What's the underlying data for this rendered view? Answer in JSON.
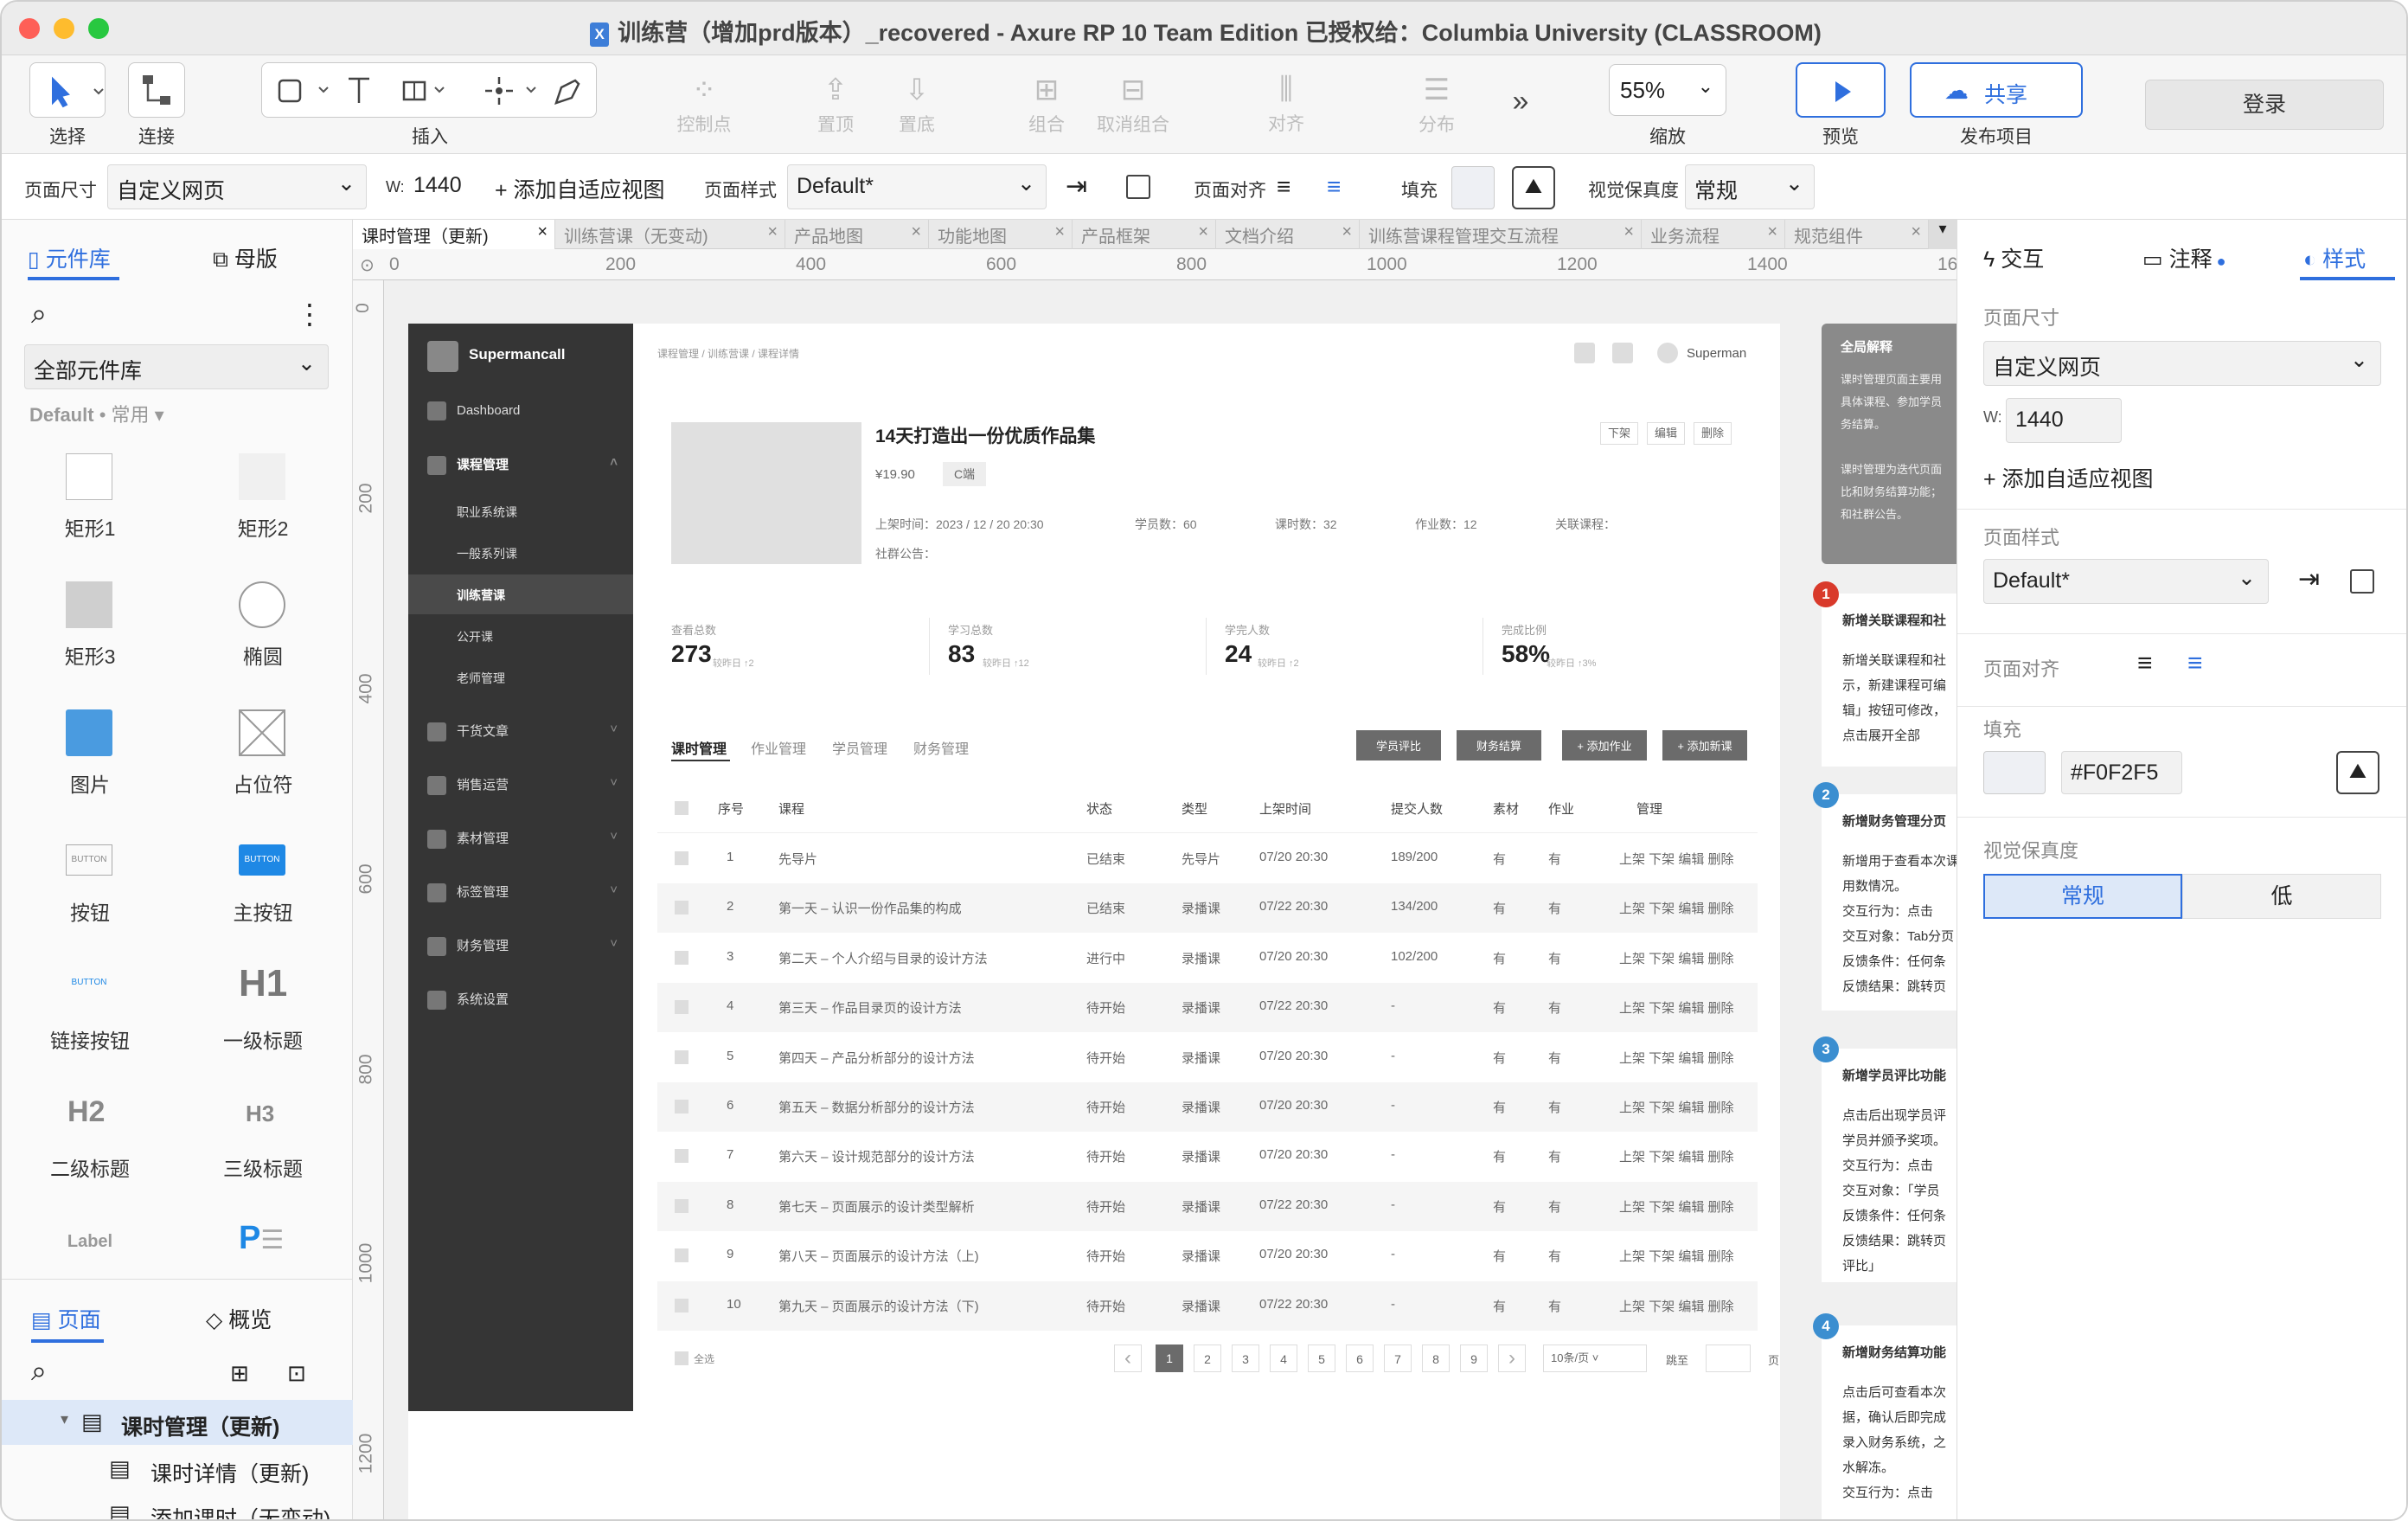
{
  "window": {
    "title": "训练营（增加prd版本）_recovered - Axure RP 10 Team Edition  已授权给：Columbia University (CLASSROOM)"
  },
  "toolbar": {
    "select": "选择",
    "connect": "连接",
    "insert": "插入",
    "control_points": "控制点",
    "front": "置顶",
    "back": "置底",
    "group": "组合",
    "ungroup": "取消组合",
    "align": "对齐",
    "distribute": "分布",
    "more": "»",
    "zoom_value": "55%",
    "zoom": "缩放",
    "preview": "预览",
    "publish": "发布项目",
    "share": "共享",
    "login": "登录"
  },
  "propbar": {
    "page_size_label": "页面尺寸",
    "page_size": "自定义网页",
    "w_label": "W:",
    "w_value": "1440",
    "add_view": "+ 添加自适应视图",
    "page_style_label": "页面样式",
    "page_style": "Default*",
    "page_align_label": "页面对齐",
    "fill_label": "填充",
    "fidelity_label": "视觉保真度",
    "fidelity": "常规"
  },
  "left": {
    "tab_library": "元件库",
    "tab_masters": "母版",
    "library_select": "全部元件库",
    "lib_default": "Default",
    "lib_common": "• 常用",
    "widgets": [
      "矩形1",
      "矩形2",
      "矩形3",
      "椭圆",
      "图片",
      "占位符",
      "按钮",
      "主按钮",
      "链接按钮",
      "一级标题",
      "二级标题",
      "三级标题",
      "Label"
    ],
    "tab_pages": "页面",
    "tab_outline": "概览",
    "pages": [
      "课时管理（更新)",
      "课时详情（更新)",
      "添加课时（无变动)"
    ]
  },
  "tabs": [
    "课时管理（更新)",
    "训练营课（无变动)",
    "产品地图",
    "功能地图",
    "产品框架",
    "文档介绍",
    "训练营课程管理交互流程",
    "业务流程",
    "规范组件"
  ],
  "ruler": {
    "h": [
      "0",
      "200",
      "400",
      "600",
      "800",
      "1000",
      "1200",
      "1400",
      "16"
    ],
    "v": [
      "0",
      "200",
      "400",
      "600",
      "800",
      "1000",
      "1200"
    ]
  },
  "proto": {
    "brand": "Supermancall",
    "user": "Superman",
    "menu": [
      "Dashboard",
      "课程管理",
      "职业系统课",
      "一般系列课",
      "训练营课",
      "公开课",
      "老师管理",
      "干货文章",
      "销售运营",
      "素材管理",
      "标签管理",
      "财务管理",
      "系统设置"
    ],
    "breadcrumb": "课程管理 / 训练营课 / 课程详情",
    "course_title": "14天打造出一份优质作品集",
    "price": "¥19.90",
    "tag": "C端",
    "meta": [
      "上架时间：2023 / 12 / 20 20:30",
      "学员数：60",
      "课时数：32",
      "作业数：12",
      "关联课程："
    ],
    "community": "社群公告：",
    "actions": [
      "下架",
      "编辑",
      "删除"
    ],
    "stats": [
      {
        "label": "查看总数",
        "value": "273",
        "delta": "较昨日 ↑2"
      },
      {
        "label": "学习总数",
        "value": "83",
        "delta": "较昨日 ↑12"
      },
      {
        "label": "学完人数",
        "value": "24",
        "delta": "较昨日 ↑2"
      },
      {
        "label": "完成比例",
        "value": "58%",
        "delta": "较昨日 ↑3%"
      }
    ],
    "subtabs": [
      "课时管理",
      "作业管理",
      "学员管理",
      "财务管理"
    ],
    "buttons": [
      "学员评比",
      "财务结算",
      "+ 添加作业",
      "+ 添加新课"
    ],
    "headers": [
      "序号",
      "课程",
      "状态",
      "类型",
      "上架时间",
      "提交人数",
      "素材",
      "作业",
      "管理"
    ],
    "rows": [
      [
        "1",
        "先导片",
        "已结束",
        "先导片",
        "07/20 20:30",
        "189/200",
        "有",
        "有"
      ],
      [
        "2",
        "第一天 – 认识一份作品集的构成",
        "已结束",
        "录播课",
        "07/22 20:30",
        "134/200",
        "有",
        "有"
      ],
      [
        "3",
        "第二天 – 个人介绍与目录的设计方法",
        "进行中",
        "录播课",
        "07/20 20:30",
        "102/200",
        "有",
        "有"
      ],
      [
        "4",
        "第三天 – 作品目录页的设计方法",
        "待开始",
        "录播课",
        "07/22 20:30",
        "-",
        "有",
        "有"
      ],
      [
        "5",
        "第四天 – 产品分析部分的设计方法",
        "待开始",
        "录播课",
        "07/20 20:30",
        "-",
        "有",
        "有"
      ],
      [
        "6",
        "第五天 – 数据分析部分的设计方法",
        "待开始",
        "录播课",
        "07/20 20:30",
        "-",
        "有",
        "有"
      ],
      [
        "7",
        "第六天 – 设计规范部分的设计方法",
        "待开始",
        "录播课",
        "07/20 20:30",
        "-",
        "有",
        "有"
      ],
      [
        "8",
        "第七天 – 页面展示的设计类型解析",
        "待开始",
        "录播课",
        "07/22 20:30",
        "-",
        "有",
        "有"
      ],
      [
        "9",
        "第八天 – 页面展示的设计方法（上)",
        "待开始",
        "录播课",
        "07/20 20:30",
        "-",
        "有",
        "有"
      ],
      [
        "10",
        "第九天 – 页面展示的设计方法（下)",
        "待开始",
        "录播课",
        "07/22 20:30",
        "-",
        "有",
        "有"
      ]
    ],
    "row_actions": "上架  下架  编辑  删除",
    "select_all": "全选",
    "pages": [
      "1",
      "2",
      "3",
      "4",
      "5",
      "6",
      "7",
      "8",
      "9"
    ],
    "page_size": "10条/页",
    "jump": "跳至",
    "page_unit": "页"
  },
  "notes": {
    "global_title": "全局解释",
    "global_body": [
      "课时管理页面主要用",
      "具体课程、参加学员",
      "务结算。",
      "",
      "课时管理为迭代页面",
      "比和财务结算功能；",
      "和社群公告。"
    ],
    "items": [
      {
        "num": "1",
        "color": "#d93a2b",
        "title": "新增关联课程和社",
        "body": [
          "新增关联课程和社",
          "示，新建课程可编",
          "辑」按钮可修改，",
          "点击展开全部"
        ]
      },
      {
        "num": "2",
        "color": "#3b8ed0",
        "title": "新增财务管理分页",
        "body": [
          "新增用于查看本次课程",
          "用数情况。",
          "交互行为：点击",
          "交互对象：Tab分页",
          "反馈条件：任何条",
          "反馈结果：跳转页"
        ]
      },
      {
        "num": "3",
        "color": "#3b8ed0",
        "title": "新增学员评比功能",
        "body": [
          "点击后出现学员评",
          "学员并颁予奖项。",
          "交互行为：点击",
          "交互对象：「学员",
          "反馈条件：任何条",
          "反馈结果：跳转页",
          "评比」"
        ]
      },
      {
        "num": "4",
        "color": "#3b8ed0",
        "title": "新增财务结算功能",
        "body": [
          "点击后可查看本次",
          "据，确认后即完成",
          "录入财务系统，之",
          "水解冻。",
          "交互行为：点击"
        ]
      }
    ]
  },
  "right": {
    "tab_interact": "交互",
    "tab_notes": "注释",
    "tab_style": "样式",
    "page_size_label": "页面尺寸",
    "page_size": "自定义网页",
    "w_label": "W:",
    "w_value": "1440",
    "add_view": "+ 添加自适应视图",
    "page_style_label": "页面样式",
    "page_style": "Default*",
    "page_align_label": "页面对齐",
    "fill_label": "填充",
    "fill_value": "#F0F2F5",
    "fidelity_label": "视觉保真度",
    "fid_normal": "常规",
    "fid_low": "低"
  },
  "colors": {
    "accent": "#2f6fde",
    "sidebar": "#353535",
    "fill": "#F0F2F5"
  }
}
